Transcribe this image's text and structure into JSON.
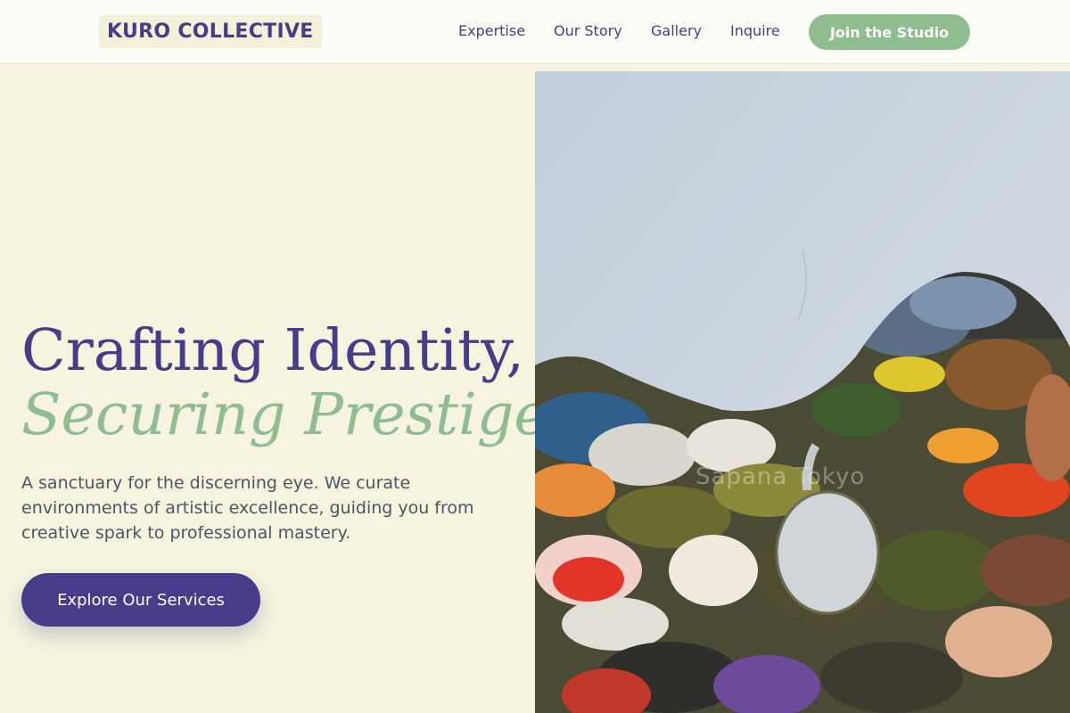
{
  "header": {
    "logo": "KURO COLLECTIVE",
    "nav": [
      "Expertise",
      "Our Story",
      "Gallery",
      "Inquire"
    ],
    "cta_label": "Join the Studio"
  },
  "hero": {
    "headline_line1": "Crafting Identity,",
    "headline_line2": "Securing Prestige.",
    "lede": "A sanctuary for the discerning eye. We curate environments of artistic excellence, guiding you from creative spark to professional mastery.",
    "button_label": "Explore Our Services",
    "image_watermark": "Sapana Tokyo"
  },
  "colors": {
    "background": "#f6f4de",
    "primary": "#463c8a",
    "accent": "#8fbd8f",
    "body_text": "#4a5566"
  }
}
